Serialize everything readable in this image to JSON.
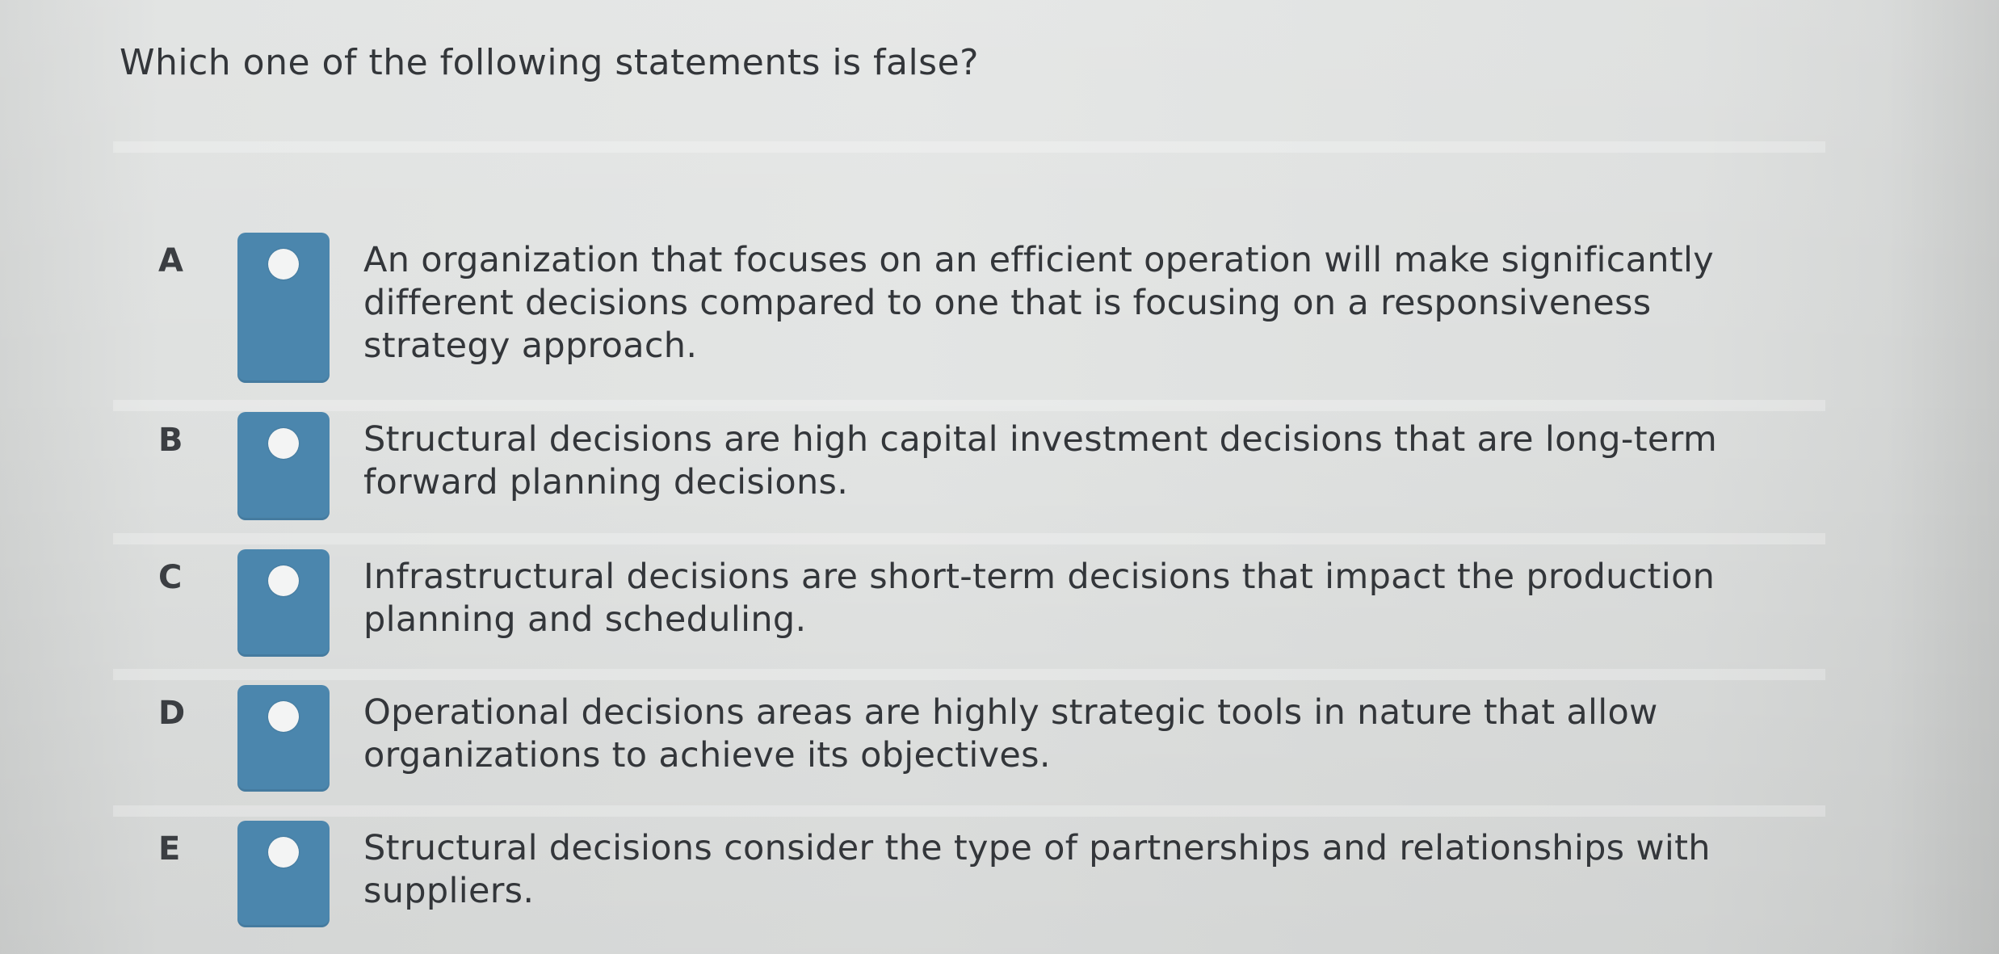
{
  "question": {
    "text": "Which one of the following statements is false?"
  },
  "options": [
    {
      "letter": "A",
      "text": "An organization that focuses on an efficient operation will make significantly different decisions compared to one that is focusing on a responsiveness strategy approach.",
      "selected": false
    },
    {
      "letter": "B",
      "text": "Structural decisions are high capital investment decisions that are long-term forward planning decisions.",
      "selected": false
    },
    {
      "letter": "C",
      "text": "Infrastructural decisions are short-term decisions that impact the production planning and scheduling.",
      "selected": false
    },
    {
      "letter": "D",
      "text": "Operational decisions areas are highly strategic tools in nature that allow organizations to achieve its objectives.",
      "selected": false
    },
    {
      "letter": "E",
      "text": "Structural decisions consider the type of partnerships and relationships with suppliers.",
      "selected": false
    }
  ],
  "colors": {
    "radio_box": "#4b86ad",
    "radio_dot": "#f3f4f4",
    "background": "#e1e3e2",
    "text": "#33363a"
  }
}
